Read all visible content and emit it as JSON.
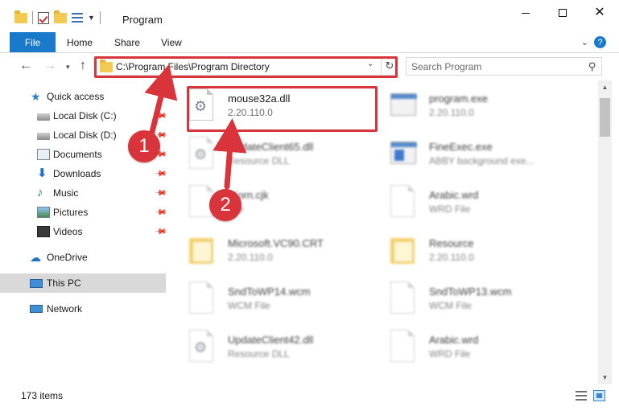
{
  "window": {
    "title": "Program",
    "minimize_glyph": "",
    "maximize_glyph": "",
    "close_glyph": "✕"
  },
  "ribbon": {
    "file": "File",
    "home": "Home",
    "share": "Share",
    "view": "View",
    "help": "?"
  },
  "address": {
    "path": "C:\\Program Files\\Program Directory",
    "search_placeholder": "Search Program"
  },
  "nav": {
    "items": [
      {
        "label": "Quick access",
        "icon": "star-icon"
      },
      {
        "label": "Local Disk (C:)",
        "icon": "disk-icon"
      },
      {
        "label": "Local Disk (D:)",
        "icon": "disk-icon"
      },
      {
        "label": "Documents",
        "icon": "documents-icon"
      },
      {
        "label": "Downloads",
        "icon": "download-arrow-icon"
      },
      {
        "label": "Music",
        "icon": "music-note-icon"
      },
      {
        "label": "Pictures",
        "icon": "pictures-icon"
      },
      {
        "label": "Videos",
        "icon": "film-icon"
      },
      {
        "label": "OneDrive",
        "icon": "cloud-icon"
      },
      {
        "label": "This PC",
        "icon": "monitor-icon"
      },
      {
        "label": "Network",
        "icon": "network-icon"
      }
    ]
  },
  "files": [
    {
      "name": "mouse32a.dll",
      "sub": "2.20.110.0",
      "icon": "dll-file-icon"
    },
    {
      "name": "program.exe",
      "sub": "2.20.110.0",
      "icon": "exe-file-icon"
    },
    {
      "name": "UpdateClient65.dll",
      "sub": "Resource DLL",
      "icon": "dll-file-icon"
    },
    {
      "name": "FineExec.exe",
      "sub": "ABBY background exe...",
      "icon": "exe-file-icon"
    },
    {
      "name": "tKorn.cjk",
      "sub": "File",
      "icon": "blank-file-icon"
    },
    {
      "name": "Arabic.wrd",
      "sub": "WRD File",
      "icon": "blank-file-icon"
    },
    {
      "name": "Microsoft.VC90.CRT",
      "sub": "2.20.110.0",
      "icon": "folder-icon"
    },
    {
      "name": "Resource",
      "sub": "2.20.110.0",
      "icon": "folder-icon"
    },
    {
      "name": "SndToWP14.wcm",
      "sub": "WCM File",
      "icon": "blank-file-icon"
    },
    {
      "name": "SndToWP13.wcm",
      "sub": "WCM File",
      "icon": "blank-file-icon"
    },
    {
      "name": "UpdateClient42.dll",
      "sub": "Resource DLL",
      "icon": "dll-file-icon"
    },
    {
      "name": "Arabic.wrd",
      "sub": "WRD File",
      "icon": "blank-file-icon"
    }
  ],
  "status": {
    "item_count": "173 items"
  },
  "annotations": {
    "step1": "1",
    "step2": "2",
    "color": "#d9343b"
  },
  "colors": {
    "accent": "#1979ca",
    "selection": "#cce8ff"
  }
}
